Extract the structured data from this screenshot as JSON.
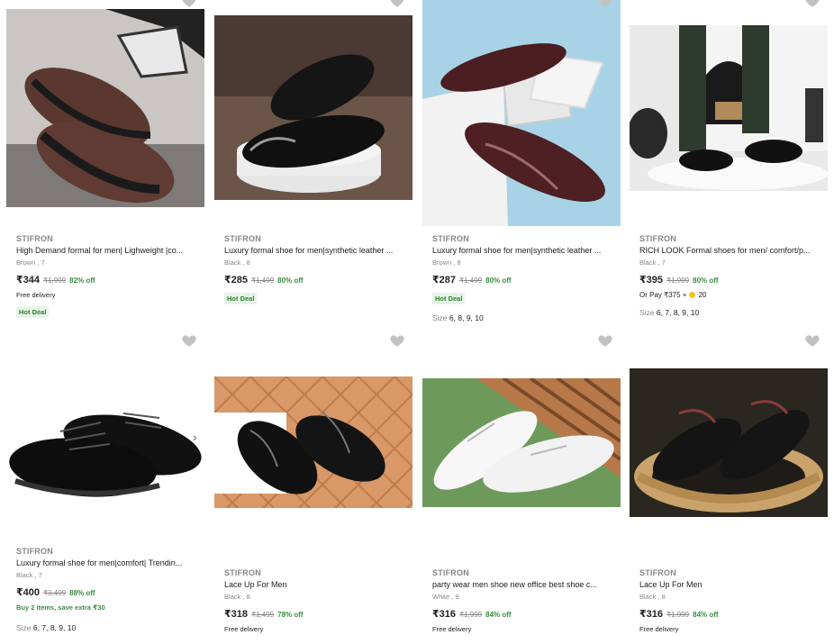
{
  "products": [
    {
      "brand": "STIFRON",
      "title": "High Demand formal for men| Lighweight |co...",
      "color": "Brown",
      "size": "7",
      "price": "₹344",
      "mrp": "₹1,999",
      "off": "82% off",
      "delivery": "Free delivery",
      "badge": "Hot Deal"
    },
    {
      "brand": "STIFRON",
      "title": "Luxury formal shoe for men|synthetic leather ...",
      "color": "Black",
      "size": "8",
      "price": "₹285",
      "mrp": "₹1,499",
      "off": "80% off",
      "badge": "Hot Deal"
    },
    {
      "brand": "STIFRON",
      "title": "Luxury formal shoe for men|synthetic leather ...",
      "color": "Brown",
      "size": "8",
      "price": "₹287",
      "mrp": "₹1,499",
      "off": "80% off",
      "badge": "Hot Deal",
      "sizes_label": "Size",
      "sizes": "6, 8, 9, 10"
    },
    {
      "brand": "STIFRON",
      "title": "RICH LOOK Formal shoes for men/ comfort/p...",
      "color": "Black",
      "size": "7",
      "price": "₹395",
      "mrp": "₹1,999",
      "off": "80% off",
      "or_pay": "Or Pay ₹375 +",
      "coins": "20",
      "sizes_label": "Size",
      "sizes": "6, 7, 8, 9, 10"
    },
    {
      "brand": "STIFRON",
      "title": "Luxury formal shoe for men|comfort| Trendin...",
      "color": "Black",
      "size": "7",
      "price": "₹400",
      "mrp": "₹3,499",
      "off": "88% off",
      "offer": "Buy 2 items, save extra ₹30",
      "sizes_label": "Size",
      "sizes": "6, 7, 8, 9, 10"
    },
    {
      "brand": "STIFRON",
      "title": "Lace Up For Men",
      "color": "Black",
      "size": "8",
      "price": "₹318",
      "mrp": "₹1,499",
      "off": "78% off",
      "delivery": "Free delivery"
    },
    {
      "brand": "STIFRON",
      "title": "party wear men shoe new office best shoe c...",
      "color": "White",
      "size": "9",
      "price": "₹316",
      "mrp": "₹1,999",
      "off": "84% off",
      "delivery": "Free delivery"
    },
    {
      "brand": "STIFRON",
      "title": "Lace Up For Men",
      "color": "Black",
      "size": "8",
      "price": "₹316",
      "mrp": "₹1,999",
      "off": "84% off",
      "delivery": "Free delivery"
    }
  ],
  "icons": {
    "wishlist": "heart-icon",
    "carousel_next": "chevron-right-icon",
    "coin": "supercoin-icon"
  },
  "colors": {
    "discount": "#388e3c",
    "muted": "#878787",
    "wishlist": "#c2c2c2",
    "badge_bg": "#e6f4e8"
  },
  "carousel_arrow": "›"
}
